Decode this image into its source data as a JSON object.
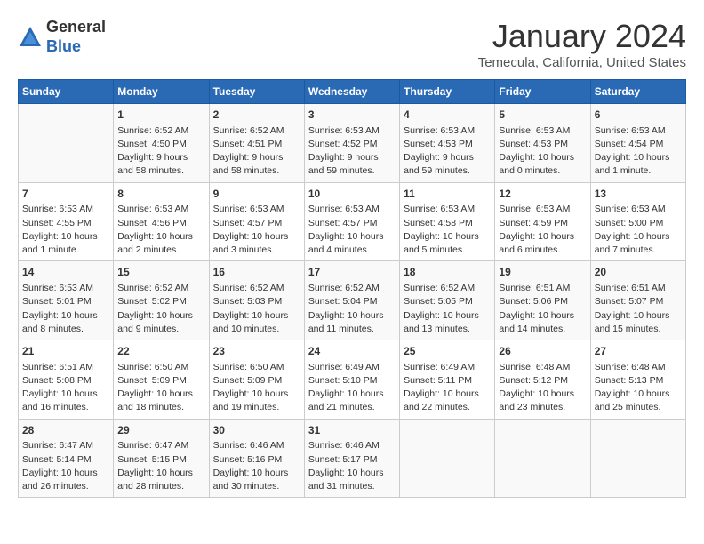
{
  "header": {
    "logo_general": "General",
    "logo_blue": "Blue",
    "month_title": "January 2024",
    "subtitle": "Temecula, California, United States"
  },
  "days_of_week": [
    "Sunday",
    "Monday",
    "Tuesday",
    "Wednesday",
    "Thursday",
    "Friday",
    "Saturday"
  ],
  "weeks": [
    [
      {
        "day": "",
        "info": ""
      },
      {
        "day": "1",
        "info": "Sunrise: 6:52 AM\nSunset: 4:50 PM\nDaylight: 9 hours\nand 58 minutes."
      },
      {
        "day": "2",
        "info": "Sunrise: 6:52 AM\nSunset: 4:51 PM\nDaylight: 9 hours\nand 58 minutes."
      },
      {
        "day": "3",
        "info": "Sunrise: 6:53 AM\nSunset: 4:52 PM\nDaylight: 9 hours\nand 59 minutes."
      },
      {
        "day": "4",
        "info": "Sunrise: 6:53 AM\nSunset: 4:53 PM\nDaylight: 9 hours\nand 59 minutes."
      },
      {
        "day": "5",
        "info": "Sunrise: 6:53 AM\nSunset: 4:53 PM\nDaylight: 10 hours\nand 0 minutes."
      },
      {
        "day": "6",
        "info": "Sunrise: 6:53 AM\nSunset: 4:54 PM\nDaylight: 10 hours\nand 1 minute."
      }
    ],
    [
      {
        "day": "7",
        "info": "Sunrise: 6:53 AM\nSunset: 4:55 PM\nDaylight: 10 hours\nand 1 minute."
      },
      {
        "day": "8",
        "info": "Sunrise: 6:53 AM\nSunset: 4:56 PM\nDaylight: 10 hours\nand 2 minutes."
      },
      {
        "day": "9",
        "info": "Sunrise: 6:53 AM\nSunset: 4:57 PM\nDaylight: 10 hours\nand 3 minutes."
      },
      {
        "day": "10",
        "info": "Sunrise: 6:53 AM\nSunset: 4:57 PM\nDaylight: 10 hours\nand 4 minutes."
      },
      {
        "day": "11",
        "info": "Sunrise: 6:53 AM\nSunset: 4:58 PM\nDaylight: 10 hours\nand 5 minutes."
      },
      {
        "day": "12",
        "info": "Sunrise: 6:53 AM\nSunset: 4:59 PM\nDaylight: 10 hours\nand 6 minutes."
      },
      {
        "day": "13",
        "info": "Sunrise: 6:53 AM\nSunset: 5:00 PM\nDaylight: 10 hours\nand 7 minutes."
      }
    ],
    [
      {
        "day": "14",
        "info": "Sunrise: 6:53 AM\nSunset: 5:01 PM\nDaylight: 10 hours\nand 8 minutes."
      },
      {
        "day": "15",
        "info": "Sunrise: 6:52 AM\nSunset: 5:02 PM\nDaylight: 10 hours\nand 9 minutes."
      },
      {
        "day": "16",
        "info": "Sunrise: 6:52 AM\nSunset: 5:03 PM\nDaylight: 10 hours\nand 10 minutes."
      },
      {
        "day": "17",
        "info": "Sunrise: 6:52 AM\nSunset: 5:04 PM\nDaylight: 10 hours\nand 11 minutes."
      },
      {
        "day": "18",
        "info": "Sunrise: 6:52 AM\nSunset: 5:05 PM\nDaylight: 10 hours\nand 13 minutes."
      },
      {
        "day": "19",
        "info": "Sunrise: 6:51 AM\nSunset: 5:06 PM\nDaylight: 10 hours\nand 14 minutes."
      },
      {
        "day": "20",
        "info": "Sunrise: 6:51 AM\nSunset: 5:07 PM\nDaylight: 10 hours\nand 15 minutes."
      }
    ],
    [
      {
        "day": "21",
        "info": "Sunrise: 6:51 AM\nSunset: 5:08 PM\nDaylight: 10 hours\nand 16 minutes."
      },
      {
        "day": "22",
        "info": "Sunrise: 6:50 AM\nSunset: 5:09 PM\nDaylight: 10 hours\nand 18 minutes."
      },
      {
        "day": "23",
        "info": "Sunrise: 6:50 AM\nSunset: 5:09 PM\nDaylight: 10 hours\nand 19 minutes."
      },
      {
        "day": "24",
        "info": "Sunrise: 6:49 AM\nSunset: 5:10 PM\nDaylight: 10 hours\nand 21 minutes."
      },
      {
        "day": "25",
        "info": "Sunrise: 6:49 AM\nSunset: 5:11 PM\nDaylight: 10 hours\nand 22 minutes."
      },
      {
        "day": "26",
        "info": "Sunrise: 6:48 AM\nSunset: 5:12 PM\nDaylight: 10 hours\nand 23 minutes."
      },
      {
        "day": "27",
        "info": "Sunrise: 6:48 AM\nSunset: 5:13 PM\nDaylight: 10 hours\nand 25 minutes."
      }
    ],
    [
      {
        "day": "28",
        "info": "Sunrise: 6:47 AM\nSunset: 5:14 PM\nDaylight: 10 hours\nand 26 minutes."
      },
      {
        "day": "29",
        "info": "Sunrise: 6:47 AM\nSunset: 5:15 PM\nDaylight: 10 hours\nand 28 minutes."
      },
      {
        "day": "30",
        "info": "Sunrise: 6:46 AM\nSunset: 5:16 PM\nDaylight: 10 hours\nand 30 minutes."
      },
      {
        "day": "31",
        "info": "Sunrise: 6:46 AM\nSunset: 5:17 PM\nDaylight: 10 hours\nand 31 minutes."
      },
      {
        "day": "",
        "info": ""
      },
      {
        "day": "",
        "info": ""
      },
      {
        "day": "",
        "info": ""
      }
    ]
  ]
}
